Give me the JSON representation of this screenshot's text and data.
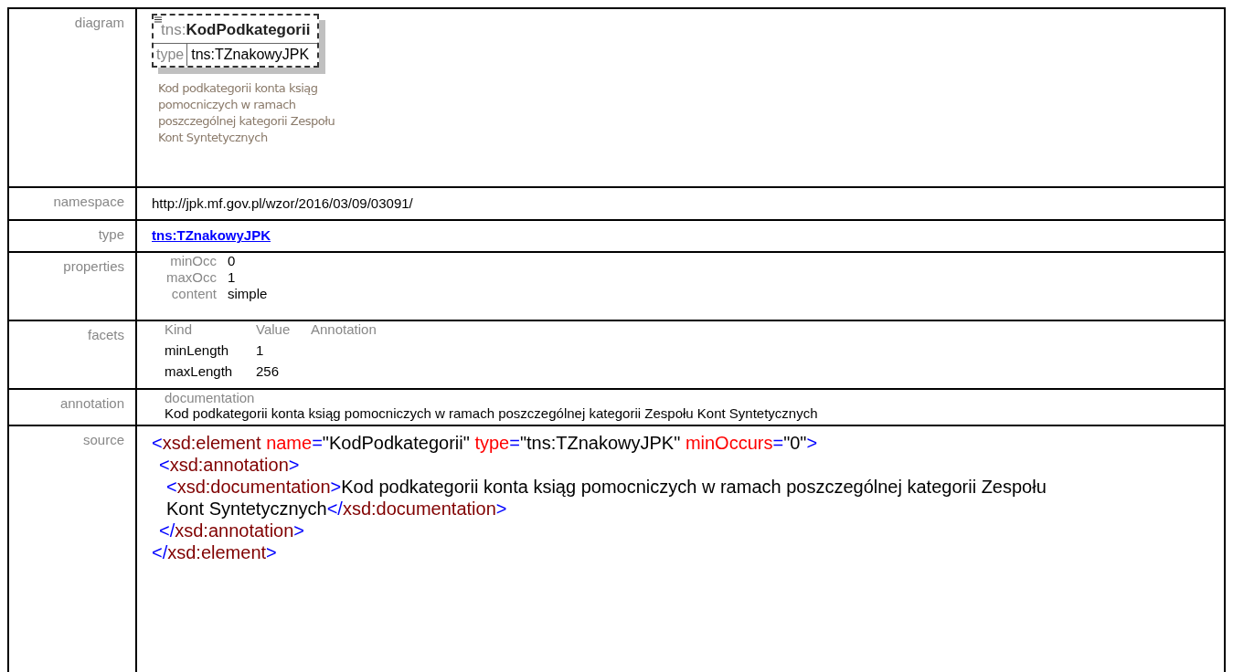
{
  "diagram": {
    "label": "diagram",
    "prefix": "tns:",
    "name": "KodPodkategorii",
    "type_label": "type",
    "type_value": "tns:TZnakowyJPK",
    "description": "Kod podkategorii konta ksiąg pomocniczych w ramach poszczególnej kategorii Zespołu Kont Syntetycznych"
  },
  "namespace": {
    "label": "namespace",
    "value": "http://jpk.mf.gov.pl/wzor/2016/03/09/03091/"
  },
  "type": {
    "label": "type",
    "link": "tns:TZnakowyJPK"
  },
  "properties": {
    "label": "properties",
    "items": [
      {
        "name": "minOcc",
        "value": "0"
      },
      {
        "name": "maxOcc",
        "value": "1"
      },
      {
        "name": "content",
        "value": "simple"
      }
    ]
  },
  "facets": {
    "label": "facets",
    "columns": [
      "Kind",
      "Value",
      "Annotation"
    ],
    "rows": [
      {
        "kind": "minLength",
        "value": "1"
      },
      {
        "kind": "maxLength",
        "value": "256"
      }
    ]
  },
  "annotation": {
    "label": "annotation",
    "heading": "documentation",
    "text": "Kod podkategorii konta ksiąg pomocniczych w ramach poszczególnej kategorii Zespołu Kont Syntetycznych"
  },
  "source": {
    "label": "source",
    "nodes": [
      {
        "open": [
          {
            "kind": "punct",
            "text": "<"
          },
          {
            "kind": "tag",
            "text": "xsd:element"
          },
          {
            "kind": "attr",
            "text": "name"
          },
          {
            "kind": "punct",
            "text": "="
          },
          {
            "kind": "value",
            "text": "\"KodPodkategorii\""
          },
          {
            "kind": "attr",
            "text": "type"
          },
          {
            "kind": "punct",
            "text": "="
          },
          {
            "kind": "value",
            "text": "\"tns:TZnakowyJPK\""
          },
          {
            "kind": "attr",
            "text": "minOccurs"
          },
          {
            "kind": "punct",
            "text": "="
          },
          {
            "kind": "value",
            "text": "\"0\""
          },
          {
            "kind": "punct",
            "text": ">"
          }
        ],
        "close": [
          {
            "kind": "punct",
            "text": "</"
          },
          {
            "kind": "tag",
            "text": "xsd:element"
          },
          {
            "kind": "punct",
            "text": ">"
          }
        ],
        "children": [
          {
            "open": [
              {
                "kind": "punct",
                "text": "<"
              },
              {
                "kind": "tag",
                "text": "xsd:annotation"
              },
              {
                "kind": "punct",
                "text": ">"
              }
            ],
            "close": [
              {
                "kind": "punct",
                "text": "</"
              },
              {
                "kind": "tag",
                "text": "xsd:annotation"
              },
              {
                "kind": "punct",
                "text": ">"
              }
            ],
            "children": [
              {
                "open": [
                  {
                    "kind": "punct",
                    "text": "<"
                  },
                  {
                    "kind": "tag",
                    "text": "xsd:documentation"
                  },
                  {
                    "kind": "punct",
                    "text": ">"
                  },
                  {
                    "kind": "value",
                    "text": "Kod podkategorii konta ksiąg pomocniczych w ramach poszczególnej kategorii Zespołu Kont Syntetycznych"
                  },
                  {
                    "kind": "punct",
                    "text": "</"
                  },
                  {
                    "kind": "tag",
                    "text": "xsd:documentation"
                  },
                  {
                    "kind": "punct",
                    "text": ">"
                  }
                ]
              }
            ]
          }
        ]
      }
    ]
  }
}
